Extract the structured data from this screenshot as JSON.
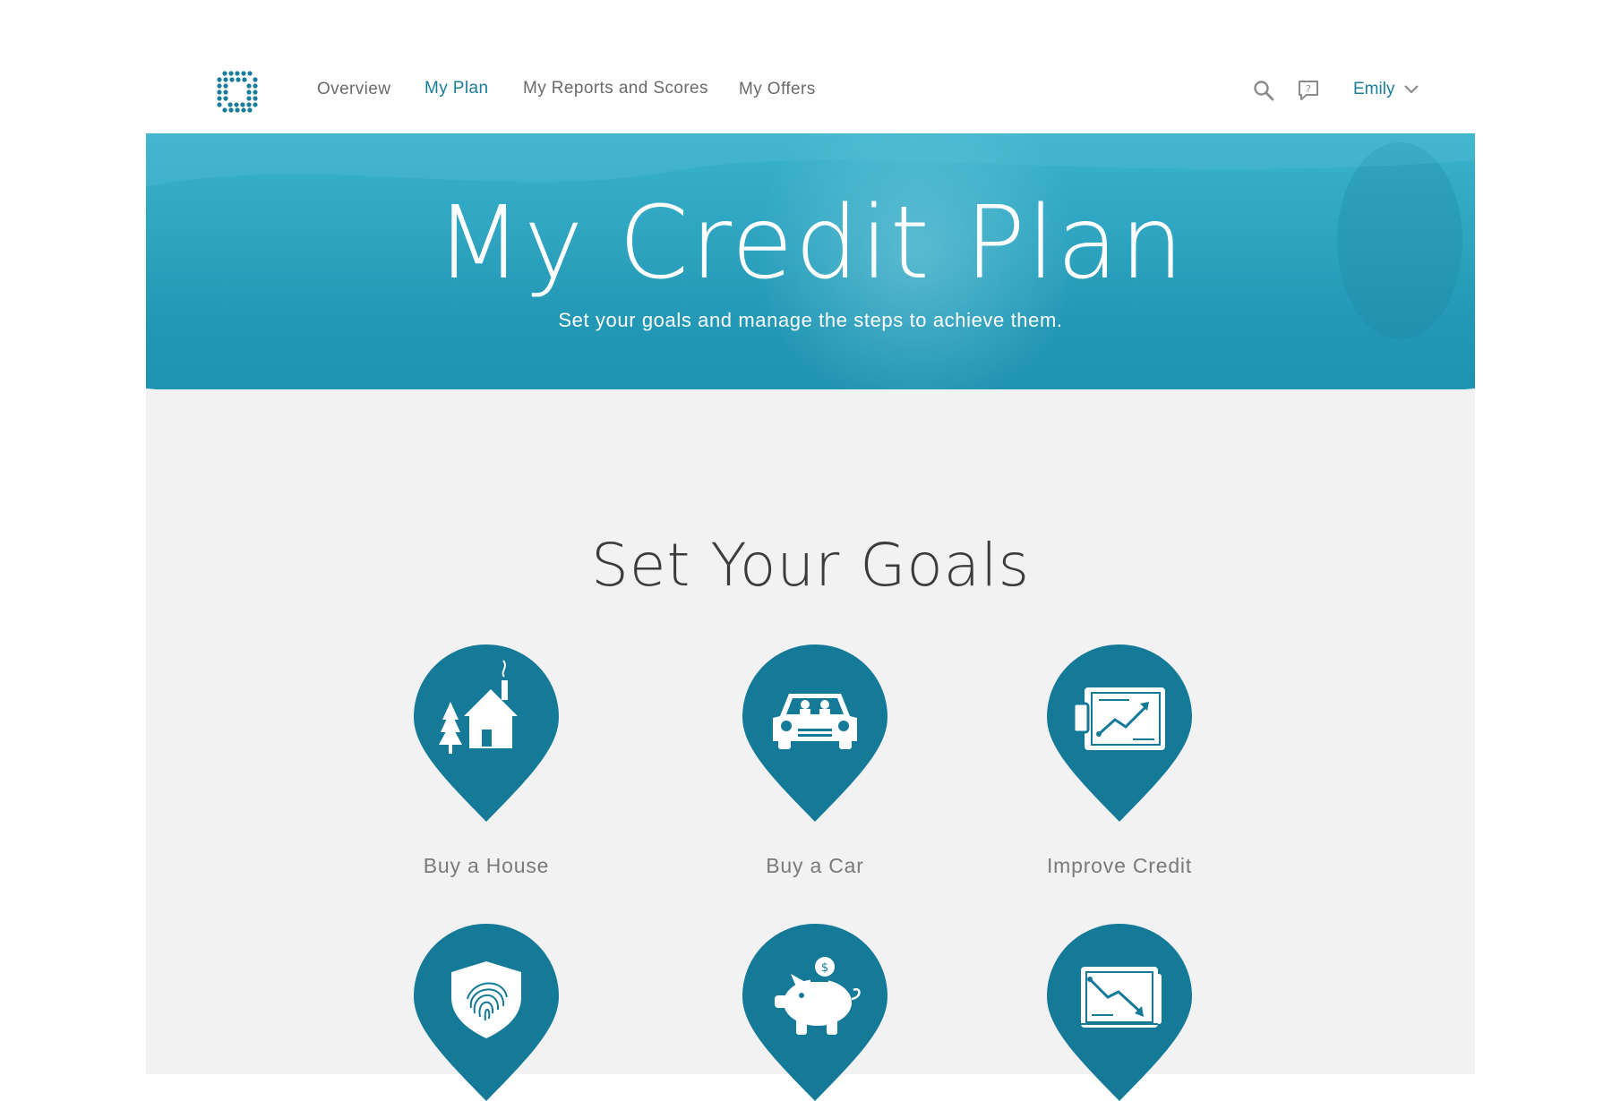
{
  "colors": {
    "brand": "#1a7d9c",
    "pin": "#147a98",
    "hero": "#2aa3c0",
    "section_bg": "#f2f2f2",
    "nav_text": "#6a6a6a"
  },
  "header": {
    "logo_icon": "dotted-square-logo-icon",
    "nav": [
      {
        "label": "Overview",
        "active": false
      },
      {
        "label": "My Plan",
        "active": true
      },
      {
        "label": "My Reports and Scores",
        "active": false
      },
      {
        "label": "My Offers",
        "active": false
      }
    ],
    "search_icon": "search-icon",
    "help_icon": "help-chat-icon",
    "user": {
      "name": "Emily",
      "menu_icon": "chevron-down-icon"
    }
  },
  "hero": {
    "title": "My Credit Plan",
    "subtitle": "Set your goals and manage the steps to achieve them."
  },
  "goals": {
    "title": "Set Your Goals",
    "items": [
      {
        "label": "Buy a House",
        "icon": "house-icon"
      },
      {
        "label": "Buy a Car",
        "icon": "car-icon"
      },
      {
        "label": "Improve Credit",
        "icon": "credit-trend-up-icon"
      },
      {
        "label": "",
        "icon": "fingerprint-shield-icon"
      },
      {
        "label": "",
        "icon": "piggy-bank-icon"
      },
      {
        "label": "",
        "icon": "credit-trend-down-icon"
      }
    ]
  }
}
